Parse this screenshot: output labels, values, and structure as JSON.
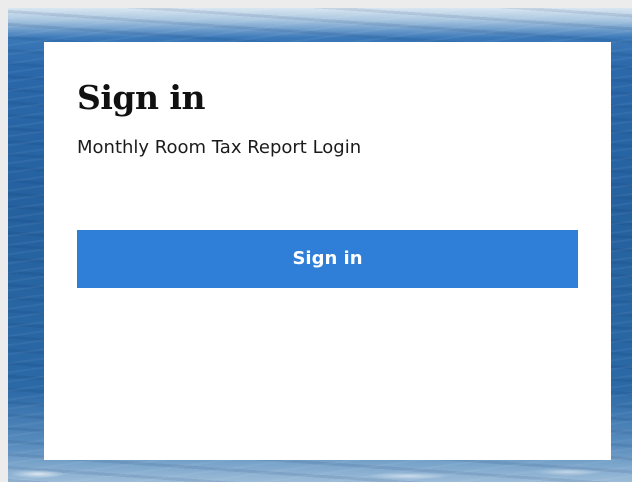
{
  "colors": {
    "page_background": "#ececec",
    "card_background": "#ffffff",
    "primary_button": "#2f7ed8",
    "button_text": "#ffffff",
    "heading_text": "#111111",
    "ocean_blue": "#25619f"
  },
  "login": {
    "title": "Sign in",
    "subtitle": "Monthly Room Tax Report Login",
    "button_label": "Sign in"
  }
}
